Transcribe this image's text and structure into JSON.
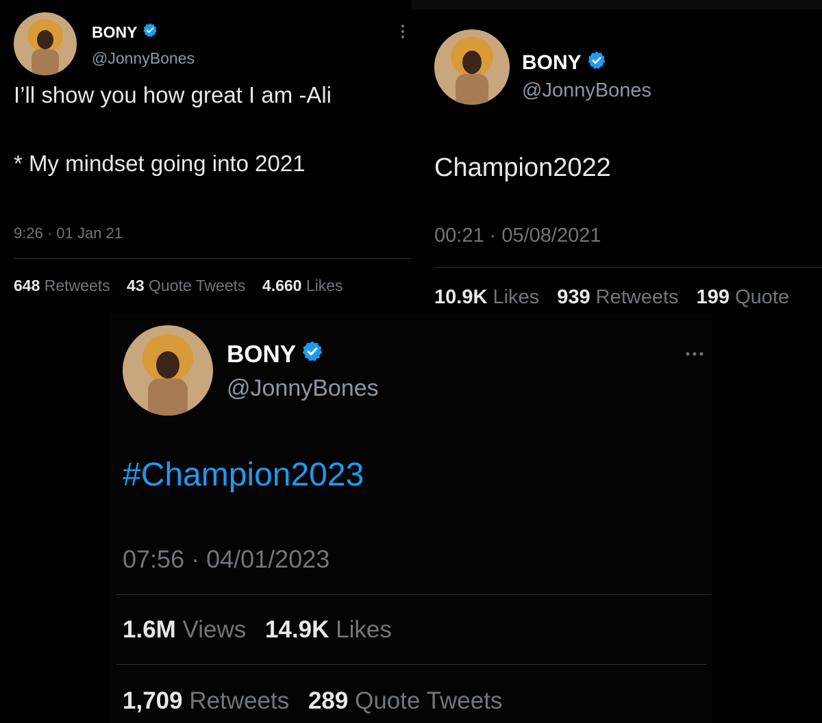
{
  "tweet1": {
    "name": "BONY",
    "handle": "@JonnyBones",
    "line1": "I’ll show you how great I am -Ali",
    "line2": "* My mindset going into 2021",
    "time": "9:26 · 01 Jan 21",
    "stats": [
      {
        "count": "648",
        "label": "Retweets"
      },
      {
        "count": "43",
        "label": "Quote Tweets"
      },
      {
        "count": "4.660",
        "label": "Likes"
      }
    ]
  },
  "tweet2": {
    "name": "BONY",
    "handle": "@JonnyBones",
    "text": "Champion2022",
    "time": "00:21 · 05/08/2021",
    "stats": [
      {
        "count": "10.9K",
        "label": "Likes"
      },
      {
        "count": "939",
        "label": "Retweets"
      },
      {
        "count": "199",
        "label": "Quote"
      }
    ]
  },
  "tweet3": {
    "name": "BONY",
    "handle": "@JonnyBones",
    "text": "#Champion2023",
    "time": "07:56 · 04/01/2023",
    "stats_row1": [
      {
        "count": "1.6M",
        "label": "Views"
      },
      {
        "count": "14.9K",
        "label": "Likes"
      }
    ],
    "stats_row2": [
      {
        "count": "1,709",
        "label": "Retweets"
      },
      {
        "count": "289",
        "label": "Quote Tweets"
      }
    ]
  },
  "icons": {
    "verified": "verified-badge-icon",
    "more": "more-options-icon",
    "avatar": "lion-headdress-avatar"
  },
  "colors": {
    "background": "#000000",
    "text": "#e7e9ea",
    "muted": "#71767b",
    "link": "#1d9bf0",
    "verified": "#1d9bf0"
  }
}
